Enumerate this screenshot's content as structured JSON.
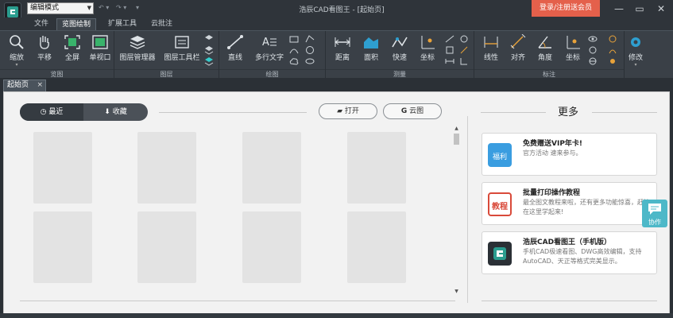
{
  "titlebar": {
    "mode_select": "编辑模式",
    "title": "浩辰CAD看图王 - [起始页]",
    "login_button": "登录/注册送会员",
    "minimize": "—",
    "maximize": "▭",
    "close": "✕"
  },
  "menu": {
    "tabs": [
      {
        "label": "文件"
      },
      {
        "label": "览图绘制"
      },
      {
        "label": "扩展工具"
      },
      {
        "label": "云批注"
      }
    ]
  },
  "ribbon": {
    "groups": [
      {
        "label": "览图"
      },
      {
        "label": "图层"
      },
      {
        "label": "绘图"
      },
      {
        "label": "测量"
      },
      {
        "label": "标注"
      }
    ],
    "tools": {
      "zoom": "缩放",
      "pan": "平移",
      "fullscreen": "全屏",
      "single_view": "单视口",
      "layer_manager": "图层管理器",
      "layer_toolbar": "图层工具栏",
      "line": "直线",
      "mtext": "多行文字",
      "distance": "距离",
      "area": "面积",
      "quick_measure": "快速",
      "coordinate": "坐标",
      "linear": "线性",
      "aligned": "对齐",
      "angle": "角度",
      "dim_coordinate": "坐标",
      "modify": "修改"
    }
  },
  "page_tab": {
    "label": "起始页",
    "close": "×"
  },
  "start": {
    "recent": "最近",
    "favorites": "收藏",
    "open": "打开",
    "cloud": "云图",
    "more_title": "更多"
  },
  "cards": [
    {
      "title": "免费赠送VIP年卡!",
      "desc": "官方活动  速来参与。",
      "icon_text": "福利"
    },
    {
      "title": "批量打印操作教程",
      "desc": "最全图文教程来啦，还有更多功能惊喜，赶快在这里学起来!",
      "icon_text": "教程"
    },
    {
      "title": "浩辰CAD看图王（手机版）",
      "desc": "手机CAD极速看图、DWG高效编辑，支持AutoCAD、天正等格式完美显示。",
      "icon_text": ""
    }
  ],
  "collab": {
    "label": "协作"
  },
  "colors": {
    "accent": "#e4604b",
    "collab": "#4db8c8",
    "ribbon": "#3a4047"
  }
}
